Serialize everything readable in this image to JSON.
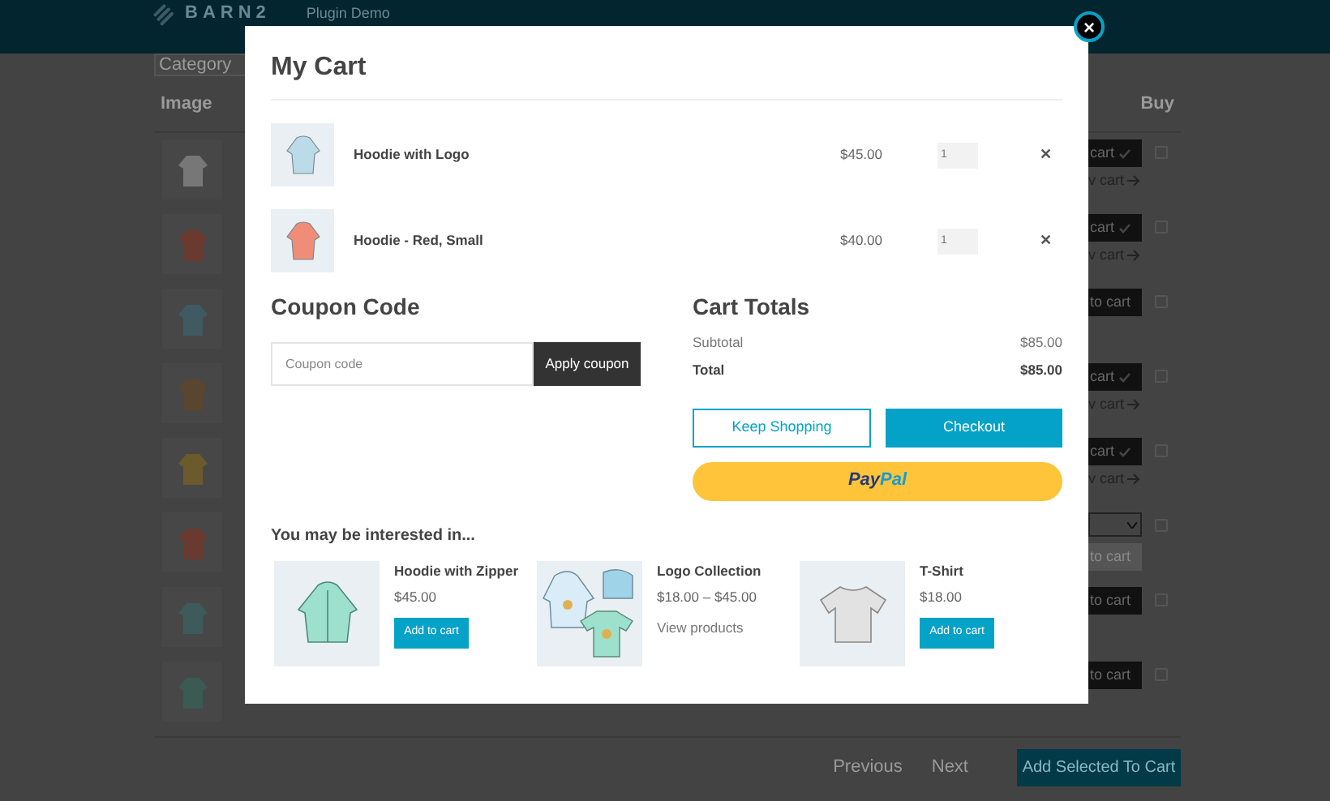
{
  "header": {
    "logo": "BARN2",
    "subtitle": "Plugin Demo"
  },
  "table": {
    "filter": "Category",
    "columns": [
      "Image",
      "Buy"
    ],
    "rows": [
      {
        "kind": "added",
        "button": "cart",
        "link": "v cart",
        "checked": false
      },
      {
        "kind": "added",
        "button": "cart",
        "link": "v cart",
        "checked": false
      },
      {
        "kind": "simple",
        "button": "to cart",
        "checked": false
      },
      {
        "kind": "added",
        "button": "cart",
        "link": "v cart",
        "checked": false
      },
      {
        "kind": "added",
        "button": "cart",
        "link": "v cart",
        "checked": false
      },
      {
        "kind": "variable",
        "button": "to cart",
        "disabled": true,
        "checked": false
      },
      {
        "kind": "simple",
        "button": "to cart",
        "checked": false
      },
      {
        "kind": "simple",
        "button": "to cart",
        "checked": false
      }
    ],
    "pagination": [
      "Previous",
      "Next"
    ],
    "submit": "Add Selected To Cart"
  },
  "modal": {
    "title": "My Cart",
    "close": "×",
    "items": [
      {
        "name": "Hoodie with Logo",
        "price": "$45.00",
        "quantity": "1",
        "remove": "✕"
      },
      {
        "name": "Hoodie - Red, Small",
        "price": "$40.00",
        "quantity": "1",
        "remove": "✕"
      }
    ],
    "coupon": {
      "heading": "Coupon Code",
      "placeholder": "Coupon code",
      "button": "Apply coupon"
    },
    "totals": {
      "heading": "Cart Totals",
      "rows": [
        {
          "label": "Subtotal",
          "value": "$85.00",
          "bold": false
        },
        {
          "label": "Total",
          "value": "$85.00",
          "bold": true
        }
      ]
    },
    "buttons": {
      "keep_shopping": "Keep Shopping",
      "checkout": "Checkout",
      "paypal_left": "Pay",
      "paypal_right": "Pal"
    },
    "recommended": {
      "heading": "You may be interested in...",
      "products": [
        {
          "name": "Hoodie with Zipper",
          "price": "$45.00",
          "kind": "button",
          "action": "Add to cart"
        },
        {
          "name": "Logo Collection",
          "price": "$18.00 – $45.00",
          "kind": "link",
          "action": "View products"
        },
        {
          "name": "T-Shirt",
          "price": "$18.00",
          "kind": "button",
          "action": "Add to cart"
        }
      ]
    }
  }
}
